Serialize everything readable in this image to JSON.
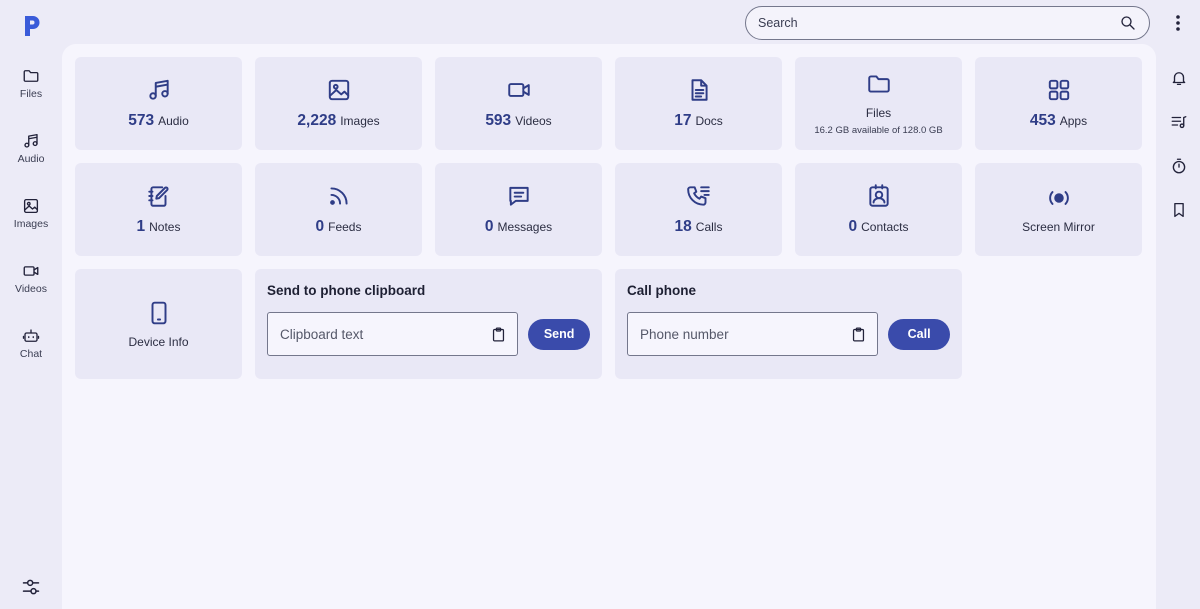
{
  "colors": {
    "accent": "#3a4bab",
    "icon": "#2f3d87",
    "tile_bg": "#e9e8f6",
    "logo": "#3a5bd9"
  },
  "search": {
    "placeholder": "Search"
  },
  "left_nav": [
    {
      "label": "Files",
      "icon": "folder-icon"
    },
    {
      "label": "Audio",
      "icon": "music-icon"
    },
    {
      "label": "Images",
      "icon": "image-icon"
    },
    {
      "label": "Videos",
      "icon": "video-icon"
    },
    {
      "label": "Chat",
      "icon": "robot-icon"
    }
  ],
  "right_rail": [
    {
      "icon": "bell-icon"
    },
    {
      "icon": "playlist-icon"
    },
    {
      "icon": "timer-icon"
    },
    {
      "icon": "bookmark-icon"
    }
  ],
  "tiles": {
    "audio": {
      "count": "573",
      "label": "Audio",
      "icon": "music-icon"
    },
    "images": {
      "count": "2,228",
      "label": "Images",
      "icon": "image-icon"
    },
    "videos": {
      "count": "593",
      "label": "Videos",
      "icon": "video-icon"
    },
    "docs": {
      "count": "17",
      "label": "Docs",
      "icon": "document-icon"
    },
    "files": {
      "label": "Files",
      "sub": "16.2 GB available of 128.0 GB",
      "icon": "folder-icon"
    },
    "apps": {
      "count": "453",
      "label": "Apps",
      "icon": "apps-grid-icon"
    },
    "notes": {
      "count": "1",
      "label": "Notes",
      "icon": "notes-icon"
    },
    "feeds": {
      "count": "0",
      "label": "Feeds",
      "icon": "rss-icon"
    },
    "messages": {
      "count": "0",
      "label": "Messages",
      "icon": "message-icon"
    },
    "calls": {
      "count": "18",
      "label": "Calls",
      "icon": "phone-log-icon"
    },
    "contacts": {
      "count": "0",
      "label": "Contacts",
      "icon": "contact-icon"
    },
    "screen_mirror": {
      "label": "Screen Mirror",
      "icon": "screen-mirror-icon"
    },
    "device_info": {
      "label": "Device Info",
      "icon": "phone-device-icon"
    }
  },
  "clipboard": {
    "title": "Send to phone clipboard",
    "placeholder": "Clipboard text",
    "button": "Send"
  },
  "call": {
    "title": "Call phone",
    "placeholder": "Phone number",
    "button": "Call"
  }
}
